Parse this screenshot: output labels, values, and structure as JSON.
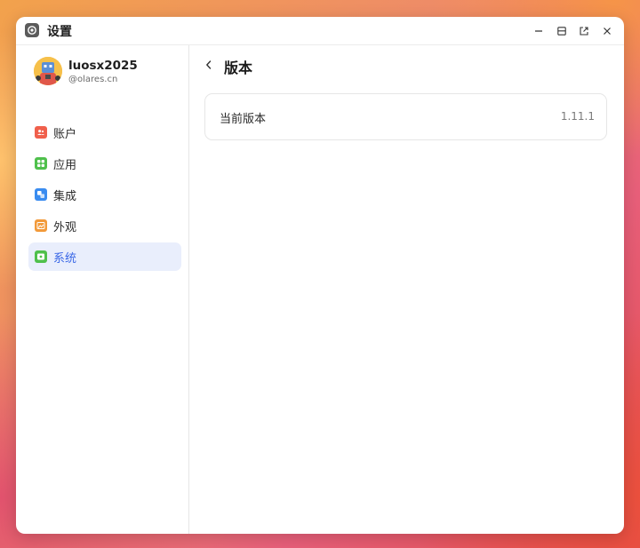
{
  "window": {
    "title": "设置",
    "app_icon": "gear-icon",
    "controls": [
      {
        "name": "minimize",
        "icon": "minimize-icon"
      },
      {
        "name": "maximize",
        "icon": "restore-icon"
      },
      {
        "name": "popout",
        "icon": "external-link-icon"
      },
      {
        "name": "close",
        "icon": "close-icon"
      }
    ]
  },
  "user": {
    "name": "luosx2025",
    "handle": "@olares.cn"
  },
  "sidebar": {
    "items": [
      {
        "label": "账户",
        "icon": "account-icon",
        "color": "#f0604c",
        "active": false
      },
      {
        "label": "应用",
        "icon": "apps-icon",
        "color": "#4fc04c",
        "active": false
      },
      {
        "label": "集成",
        "icon": "integration-icon",
        "color": "#3a8cf0",
        "active": false
      },
      {
        "label": "外观",
        "icon": "appearance-icon",
        "color": "#f29a3a",
        "active": false
      },
      {
        "label": "系统",
        "icon": "system-icon",
        "color": "#4fc04c",
        "active": true
      }
    ]
  },
  "main": {
    "back_icon": "chevron-left-icon",
    "title": "版本",
    "version_card": {
      "label": "当前版本",
      "value": "1.11.1"
    }
  },
  "colors": {
    "accent": "#3a67e6",
    "active_bg": "#e9eefc"
  }
}
